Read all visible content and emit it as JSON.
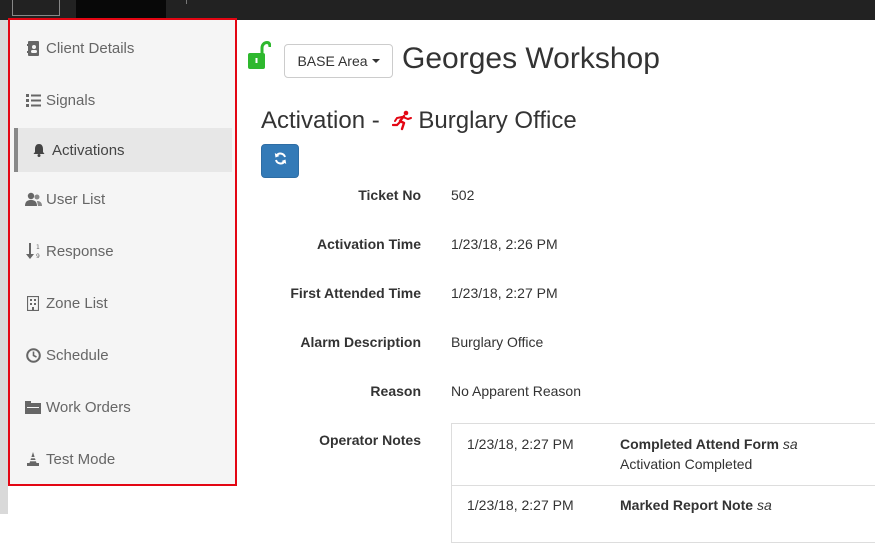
{
  "sidebar": {
    "items": [
      {
        "label": "Client Details",
        "icon": "address-book-icon"
      },
      {
        "label": "Signals",
        "icon": "list-icon"
      },
      {
        "label": "Activations",
        "icon": "bell-icon",
        "active": true
      },
      {
        "label": "User List",
        "icon": "users-icon"
      },
      {
        "label": "Response",
        "icon": "sort-numeric-icon"
      },
      {
        "label": "Zone List",
        "icon": "building-icon"
      },
      {
        "label": "Schedule",
        "icon": "clock-icon"
      },
      {
        "label": "Work Orders",
        "icon": "folder-icon"
      },
      {
        "label": "Test Mode",
        "icon": "cone-icon"
      }
    ]
  },
  "header": {
    "area_button": "BASE Area",
    "site_title": "Georges Workshop",
    "lock_icon": "unlock-icon",
    "lock_color": "#2eb82e"
  },
  "activation": {
    "prefix": "Activation - ",
    "name": "Burglary Office",
    "alarm_icon": "running-person-icon",
    "alarm_color": "#e30613"
  },
  "details": {
    "ticket_no": {
      "label": "Ticket No",
      "value": "502"
    },
    "activation_time": {
      "label": "Activation Time",
      "value": "1/23/18, 2:26 PM"
    },
    "first_attended_time": {
      "label": "First Attended Time",
      "value": "1/23/18, 2:27 PM"
    },
    "alarm_description": {
      "label": "Alarm Description",
      "value": "Burglary Office"
    },
    "reason": {
      "label": "Reason",
      "value": "No Apparent Reason"
    },
    "operator_notes": {
      "label": "Operator Notes"
    }
  },
  "notes": [
    {
      "time": "1/23/18, 2:27 PM",
      "title": "Completed Attend Form",
      "user": "sa",
      "desc": "Activation Completed"
    },
    {
      "time": "1/23/18, 2:27 PM",
      "title": "Marked Report Note",
      "user": "sa",
      "desc": ""
    }
  ],
  "colors": {
    "sidebar_border": "#e30613",
    "primary_button": "#337ab7"
  }
}
